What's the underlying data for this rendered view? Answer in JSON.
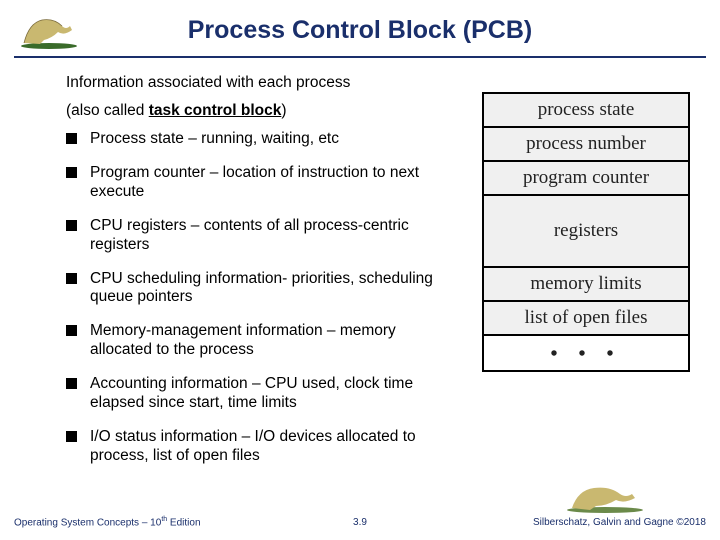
{
  "title": "Process Control Block (PCB)",
  "intro_line1": "Information associated with each process",
  "intro_line2_prefix": "(also called ",
  "intro_line2_bold": "task control block",
  "intro_line2_suffix": ")",
  "bullets": [
    "Process state – running, waiting, etc",
    "Program counter – location of instruction to next execute",
    "CPU registers – contents of all process-centric registers",
    "CPU scheduling information- priorities, scheduling queue pointers",
    "Memory-management information – memory allocated to the process",
    "Accounting information – CPU used, clock time elapsed since start, time limits",
    "I/O status information – I/O devices allocated to process, list of open files"
  ],
  "diagram": {
    "rows": [
      "process state",
      "process number",
      "program counter",
      "registers",
      "memory limits",
      "list of open files"
    ],
    "ellipsis": "• • •"
  },
  "footer": {
    "left_prefix": "Operating System Concepts – 10",
    "left_sup": "th",
    "left_suffix": " Edition",
    "center": "3.9",
    "right": "Silberschatz, Galvin and Gagne ©2018"
  }
}
